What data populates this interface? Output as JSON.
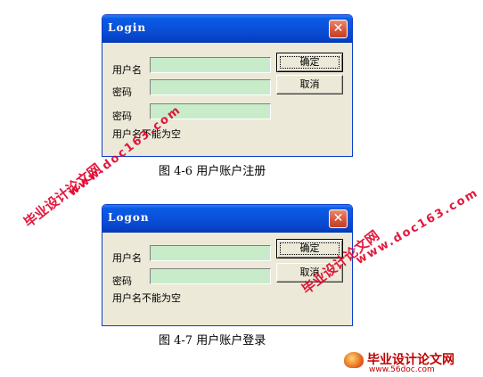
{
  "register_dialog": {
    "title": "Login",
    "close_glyph": "✕",
    "username_label": "用户名",
    "password_label": "密码",
    "confirm_password_label": "密码",
    "username_value": "",
    "password_value": "",
    "confirm_value": "",
    "ok_label": "确定",
    "cancel_label": "取消",
    "message": "用户名不能为空"
  },
  "register_caption": "图 4-6   用户账户注册",
  "login_dialog": {
    "title": "Logon",
    "close_glyph": "✕",
    "username_label": "用户名",
    "password_label": "密码",
    "username_value": "",
    "password_value": "",
    "ok_label": "确定",
    "cancel_label": "取消",
    "message": "用户名不能为空"
  },
  "login_caption": "图 4-7   用户账户登录",
  "watermarks": {
    "site_name": "毕业设计论文网",
    "site_url": "www.doc163.com"
  },
  "footer_logo": {
    "name": "毕业设计论文网",
    "url": "www.56doc.com"
  },
  "colors": {
    "titlebar": "#0a4fd8",
    "dialog_bg": "#ece9d8",
    "field_bg": "#c8ecc9",
    "watermark": "#e0002a"
  }
}
